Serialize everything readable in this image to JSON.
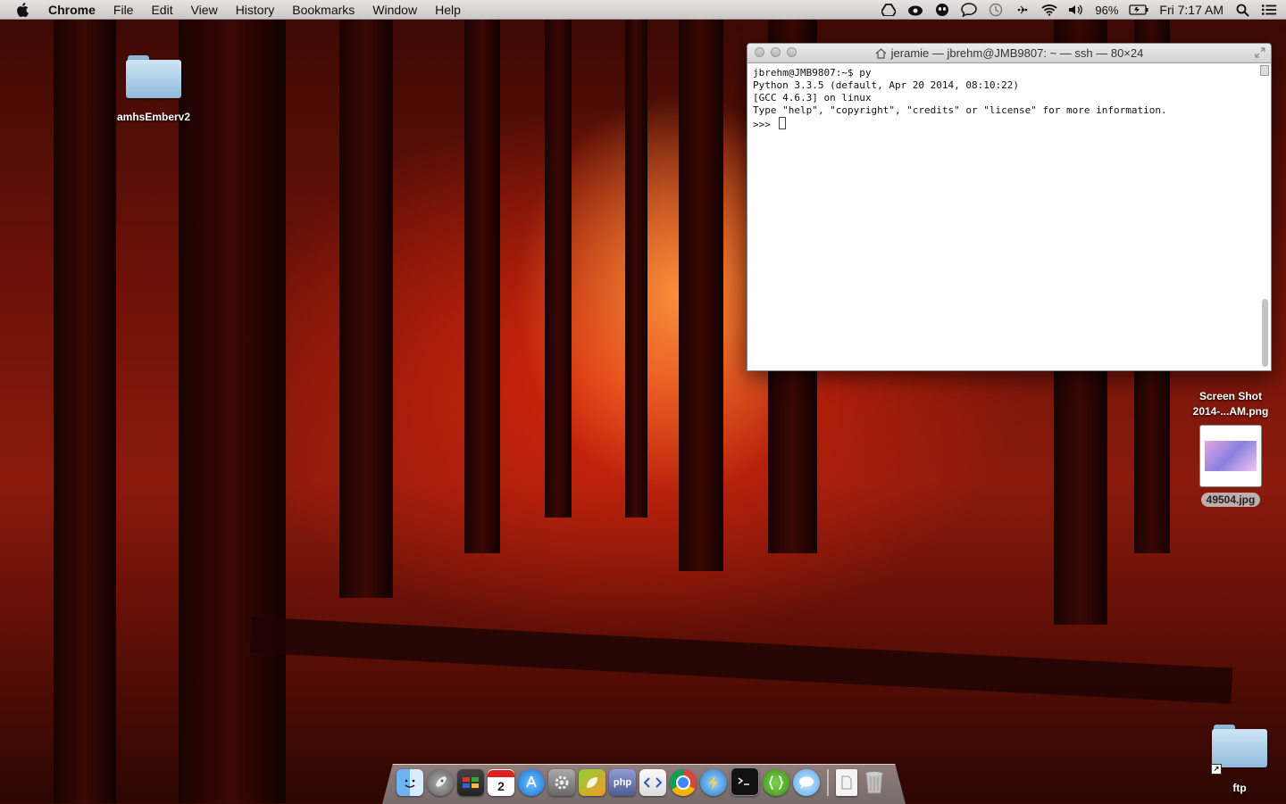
{
  "menubar": {
    "app_name": "Chrome",
    "items": [
      "File",
      "Edit",
      "View",
      "History",
      "Bookmarks",
      "Window",
      "Help"
    ],
    "battery": "96%",
    "clock": "Fri 7:17 AM"
  },
  "desktop": {
    "folder_top_left": "amhsEmberv2",
    "screenshot_file": "Screen Shot\n2014-...AM.png",
    "image_file": "49504.jpg",
    "folder_bottom_right": "ftp"
  },
  "terminal": {
    "title": "jeramie — jbrehm@JMB9807: ~ — ssh — 80×24",
    "lines": [
      "jbrehm@JMB9807:~$ py",
      "Python 3.3.5 (default, Apr 20 2014, 08:10:22)",
      "[GCC 4.6.3] on linux",
      "Type \"help\", \"copyright\", \"credits\" or \"license\" for more information.",
      ">>> "
    ]
  },
  "dock": {
    "calendar_day": "2",
    "php_label": "php"
  },
  "colors": {
    "terminal_bg": "#ffffff",
    "menubar_bg": "#e8e8e8"
  }
}
